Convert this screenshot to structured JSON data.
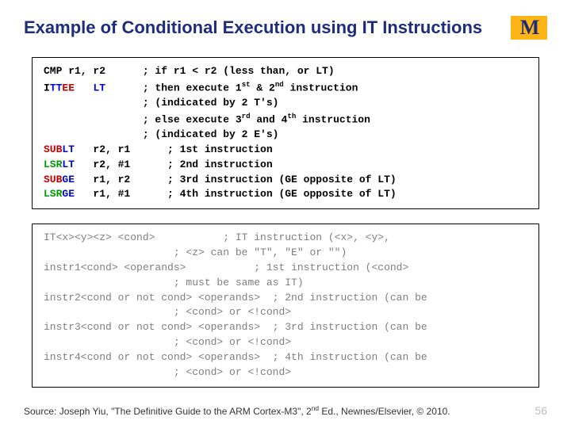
{
  "title": "Example of Conditional Execution using IT Instructions",
  "logo_letter": "M",
  "code1": {
    "l1a": "CMP r1, r2      ; if r1 < r2 (less than, or LT)",
    "l2a": "I",
    "l2b": "TT",
    "l2c": "EE",
    "l2d": "   ",
    "l2e": "LT",
    "l2f": "      ; then execute 1",
    "l2g": "st",
    "l2h": " & 2",
    "l2i": "nd",
    "l2j": " instruction",
    "l3": "                ; (indicated by 2 T's)",
    "l4a": "                ; else execute 3",
    "l4b": "rd",
    "l4c": " and 4",
    "l4d": "th",
    "l4e": " instruction",
    "l5": "                ; (indicated by 2 E's)",
    "l6a": "SUB",
    "l6b": "LT",
    "l6c": "   r2, r1      ; 1st instruction",
    "l7a": "LSR",
    "l7b": "LT",
    "l7c": "   r2, #1      ; 2nd instruction",
    "l8a": "SUB",
    "l8b": "GE",
    "l8c": "   r1, r2      ; 3rd instruction (GE opposite of LT)",
    "l9a": "LSR",
    "l9b": "GE",
    "l9c": "   r1, #1      ; 4th instruction (GE opposite of LT)"
  },
  "code2": {
    "l1": "IT<x><y><z> <cond>           ; IT instruction (<x>, <y>,",
    "l2": "                     ; <z> can be \"T\", \"E\" or \"\")",
    "l3": "instr1<cond> <operands>           ; 1st instruction (<cond>",
    "l4": "                     ; must be same as IT)",
    "l5": "instr2<cond or not cond> <operands>  ; 2nd instruction (can be",
    "l6": "                     ; <cond> or <!cond>",
    "l7": "instr3<cond or not cond> <operands>  ; 3rd instruction (can be",
    "l8": "                     ; <cond> or <!cond>",
    "l9": "instr4<cond or not cond> <operands>  ; 4th instruction (can be",
    "l10": "                     ; <cond> or <!cond>"
  },
  "source_a": "Source: Joseph Yiu, \"The Definitive Guide to the ARM Cortex-M3\", 2",
  "source_b": "nd",
  "source_c": " Ed., Newnes/Elsevier, © 2010.",
  "page": "56"
}
